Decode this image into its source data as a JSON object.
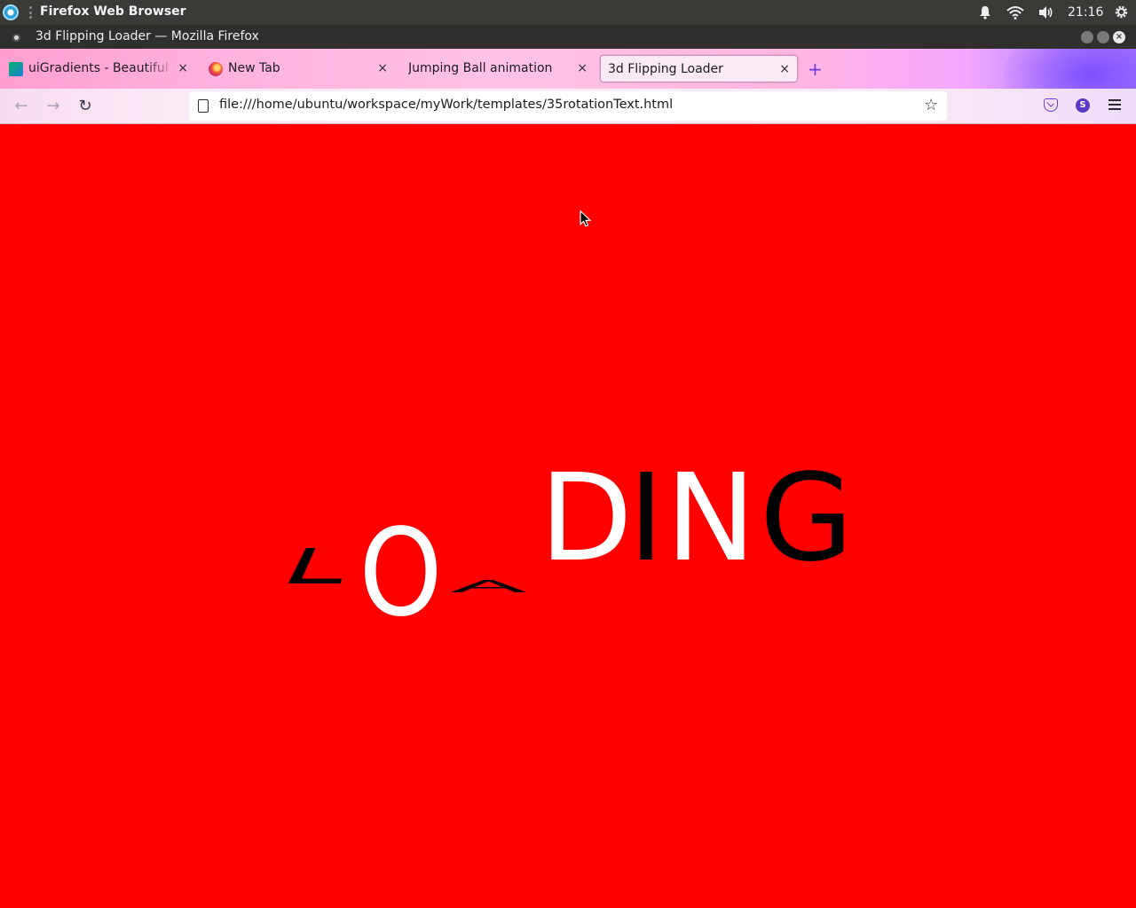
{
  "top_panel": {
    "app_name": "Firefox Web Browser",
    "clock": "21:16",
    "icons": [
      "activities-icon",
      "bell-icon",
      "wifi-icon",
      "volume-icon",
      "settings-icon"
    ]
  },
  "window": {
    "title": "3d Flipping Loader — Mozilla Firefox",
    "controls": [
      "minimize",
      "maximize",
      "close"
    ]
  },
  "tabs": [
    {
      "label": "uiGradients - Beautiful co",
      "favicon": "uigradients-icon",
      "active": false
    },
    {
      "label": "New Tab",
      "favicon": "firefox-icon",
      "active": false
    },
    {
      "label": "Jumping Ball animation",
      "favicon": "",
      "active": false
    },
    {
      "label": "3d Flipping Loader",
      "favicon": "",
      "active": true
    }
  ],
  "tab_close_glyph": "×",
  "new_tab_glyph": "+",
  "nav": {
    "back_glyph": "←",
    "forward_glyph": "→",
    "reload_glyph": "↻",
    "url": "file:///home/ubuntu/workspace/myWork/templates/35rotationText.html",
    "star_glyph": "☆",
    "account_initial": "S"
  },
  "page": {
    "background_color": "#ff0000",
    "letters": [
      "L",
      "O",
      "A",
      "D",
      "I",
      "N",
      "G"
    ]
  }
}
